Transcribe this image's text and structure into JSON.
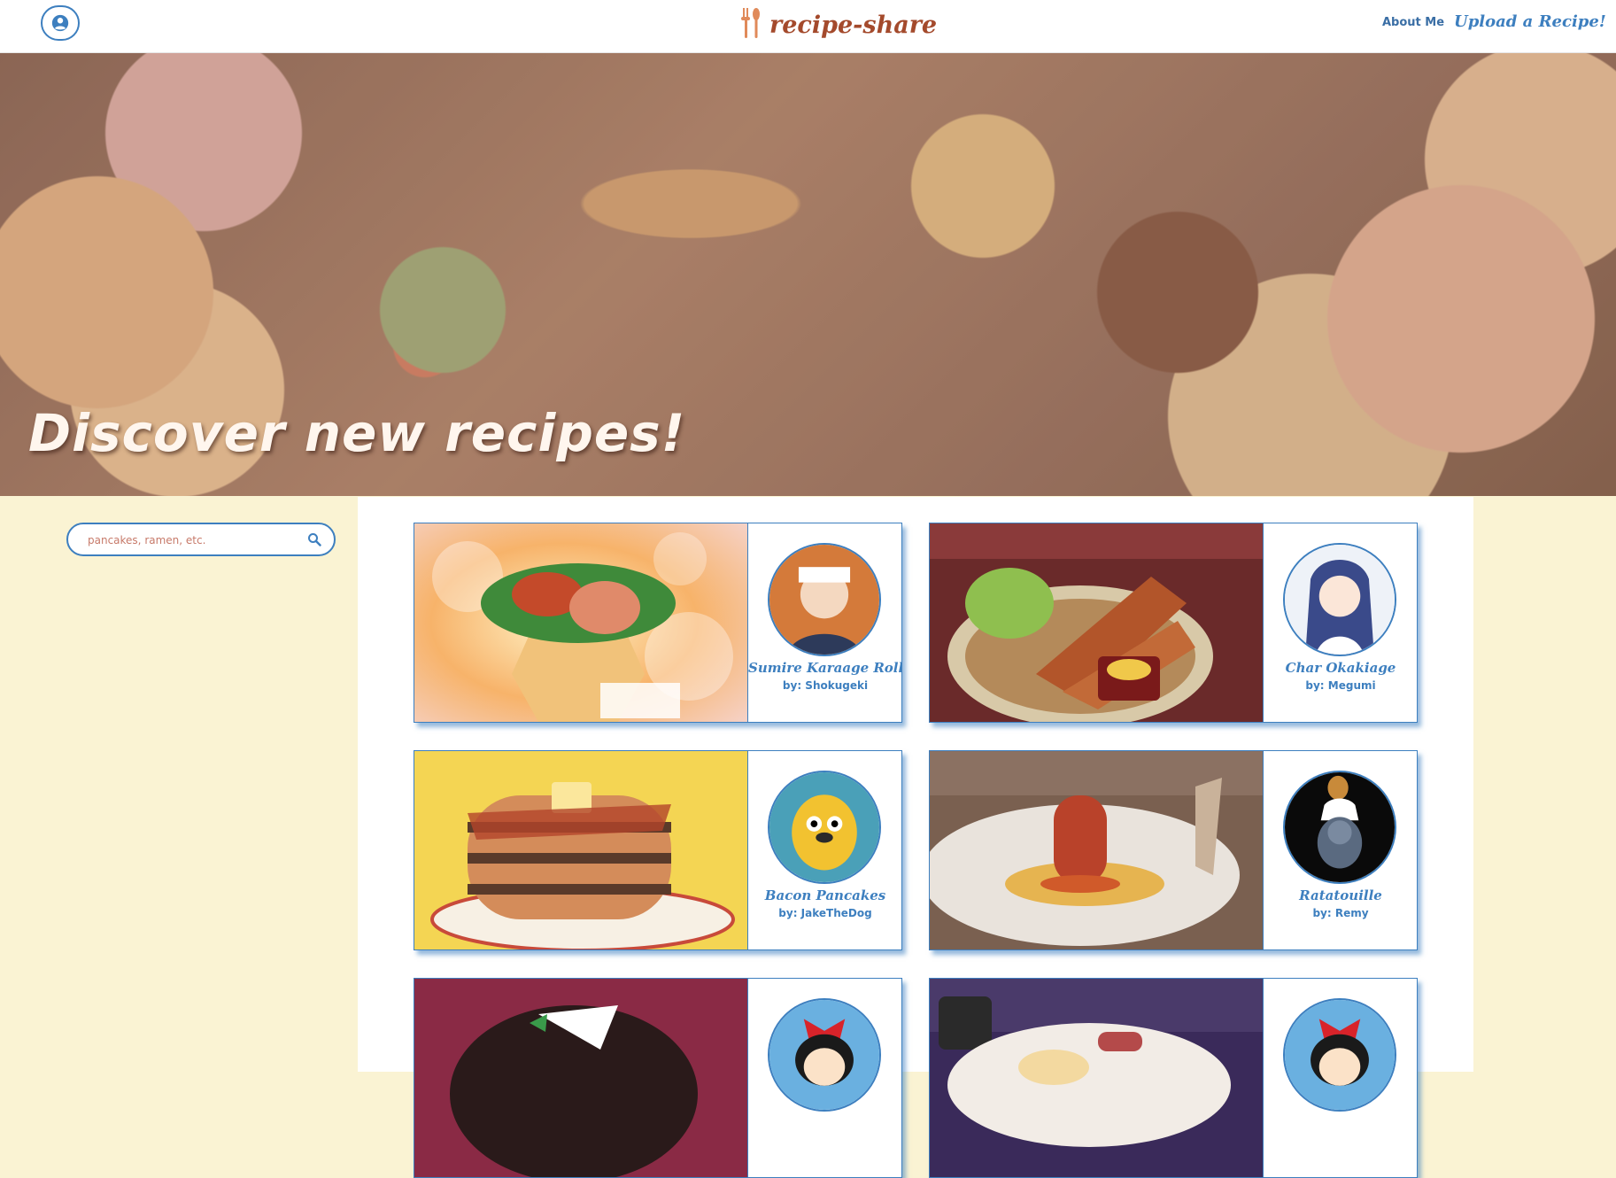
{
  "nav": {
    "brand": "recipe-share",
    "about": "About Me",
    "upload": "Upload a Recipe!"
  },
  "hero": {
    "title": "Discover new recipes!"
  },
  "search": {
    "placeholder": "pancakes, ramen, etc."
  },
  "recipes": [
    {
      "name": "Sumire Karaage Roll",
      "author": "by: Shokugeki"
    },
    {
      "name": "Char Okakiage",
      "author": "by: Megumi"
    },
    {
      "name": "Bacon Pancakes",
      "author": "by: JakeTheDog"
    },
    {
      "name": "Ratatouille",
      "author": "by: Remy"
    },
    {
      "name": "",
      "author": ""
    },
    {
      "name": "",
      "author": ""
    }
  ],
  "colors": {
    "accent": "#3d7fbf",
    "brand": "#a44a2c",
    "page_bg": "#faf3d3"
  }
}
